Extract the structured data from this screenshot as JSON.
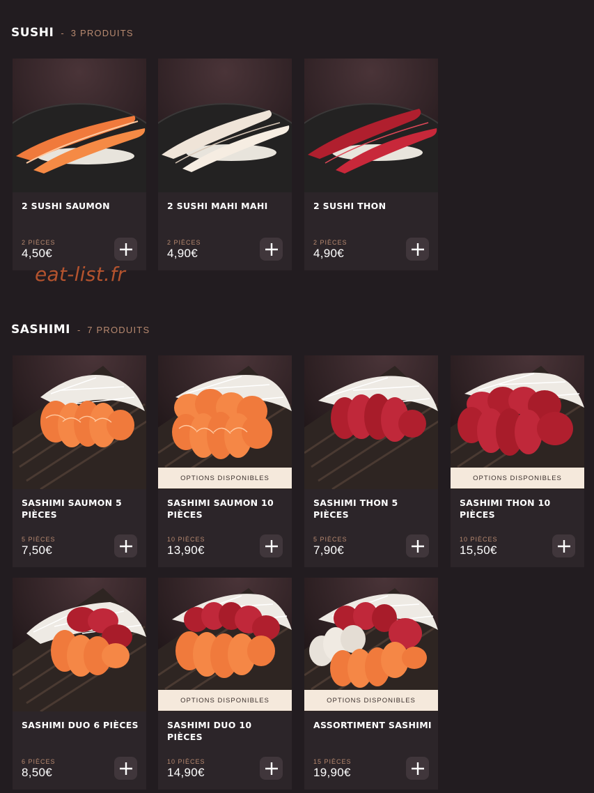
{
  "colors": {
    "background": "#221c20",
    "card": "#2c2529",
    "accent": "#b88a70",
    "options_strip": "#f5e9dc",
    "watermark": "#b4532e"
  },
  "watermark": "eat-list.fr",
  "sections": [
    {
      "title": "SUSHI",
      "separator": "-",
      "count": "3 PRODUITS",
      "products": [
        {
          "name": "2 SUSHI SAUMON",
          "qty": "2 PIÈCES",
          "price": "4,50€",
          "options": "",
          "image": "sushi-salmon-image"
        },
        {
          "name": "2 SUSHI MAHI MAHI",
          "qty": "2 PIÈCES",
          "price": "4,90€",
          "options": "",
          "image": "sushi-mahi-mahi-image"
        },
        {
          "name": "2 SUSHI THON",
          "qty": "2 PIÈCES",
          "price": "4,90€",
          "options": "",
          "image": "sushi-tuna-image"
        }
      ]
    },
    {
      "title": "SASHIMI",
      "separator": "-",
      "count": "7 PRODUITS",
      "products": [
        {
          "name": "SASHIMI SAUMON 5 PIÈCES",
          "qty": "5 PIÈCES",
          "price": "7,50€",
          "options": "",
          "image": "sashimi-salmon-image"
        },
        {
          "name": "SASHIMI SAUMON 10 PIÈCES",
          "qty": "10 PIÈCES",
          "price": "13,90€",
          "options": "OPTIONS DISPONIBLES",
          "image": "sashimi-salmon-image"
        },
        {
          "name": "SASHIMI THON 5 PIÈCES",
          "qty": "5 PIÈCES",
          "price": "7,90€",
          "options": "",
          "image": "sashimi-tuna-image"
        },
        {
          "name": "SASHIMI THON 10 PIÈCES",
          "qty": "10 PIÈCES",
          "price": "15,50€",
          "options": "OPTIONS DISPONIBLES",
          "image": "sashimi-tuna-image"
        },
        {
          "name": "SASHIMI DUO 6 PIÈCES",
          "qty": "6 PIÈCES",
          "price": "8,50€",
          "options": "",
          "image": "sashimi-duo-image"
        },
        {
          "name": "SASHIMI DUO 10 PIÈCES",
          "qty": "10 PIÈCES",
          "price": "14,90€",
          "options": "OPTIONS DISPONIBLES",
          "image": "sashimi-duo-image"
        },
        {
          "name": "ASSORTIMENT SASHIMI",
          "qty": "15 PIÈCES",
          "price": "19,90€",
          "options": "OPTIONS DISPONIBLES",
          "image": "sashimi-assortment-image"
        }
      ]
    }
  ]
}
